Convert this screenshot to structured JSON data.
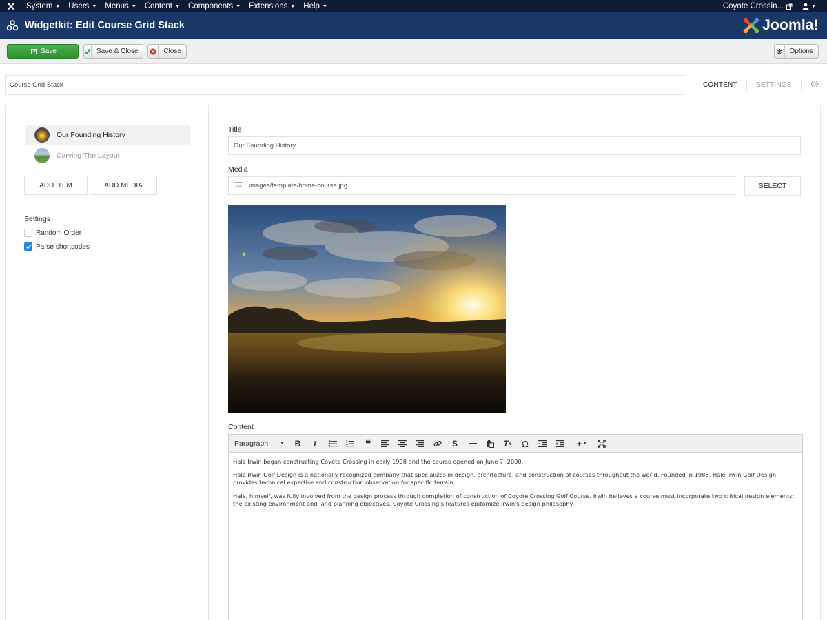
{
  "topnav": {
    "menu": [
      "System",
      "Users",
      "Menus",
      "Content",
      "Components",
      "Extensions",
      "Help"
    ],
    "site_name": "Coyote Crossin..."
  },
  "titlebar": {
    "title": "Widgetkit: Edit Course Grid Stack",
    "brand": "Joomla!"
  },
  "toolbar": {
    "save": "Save",
    "save_close": "Save & Close",
    "close": "Close",
    "options": "Options"
  },
  "widget": {
    "name": "Course Grid Stack"
  },
  "tabs": {
    "content": "CONTENT",
    "settings": "SETTINGS"
  },
  "sidebar": {
    "items": [
      {
        "label": "Our Founding History",
        "active": true
      },
      {
        "label": "Carving The Layout",
        "active": false
      }
    ],
    "add_item": "ADD ITEM",
    "add_media": "ADD MEDIA",
    "settings_title": "Settings",
    "random_order": {
      "label": "Random Order",
      "checked": false
    },
    "parse_shortcodes": {
      "label": "Parse shortcodes",
      "checked": true
    }
  },
  "form": {
    "title_label": "Title",
    "title_value": "Our Founding History",
    "media_label": "Media",
    "media_value": "images/template/home-course.jpg",
    "select_button": "SELECT",
    "content_label": "Content"
  },
  "editor": {
    "format": "Paragraph",
    "paragraphs": [
      "Hale Irwin began constructing Coyote Crossing in early 1998 and the course opened on June 7, 2000.",
      "Hale Irwin Golf Design is a nationally recognized company that specializes in design, architecture, and construction of courses throughout the world. Founded in 1986, Hale Irwin Golf Design provides technical expertise and construction observation for specific terrain.",
      "Hale, himself, was fully involved from the design process through completion of construction of Coyote Crossing Golf Course. Irwin believes a course must incorporate two critical design elements: the existing environment and land planning objectives. Coyote Crossing's features epitomize Irwin's design philosophy."
    ]
  },
  "colors": {
    "topnav_bg": "#0d1b37",
    "titlebar_bg": "#1a3867",
    "save_green": "#3a9d3d",
    "checkbox_blue": "#1e87f0"
  }
}
